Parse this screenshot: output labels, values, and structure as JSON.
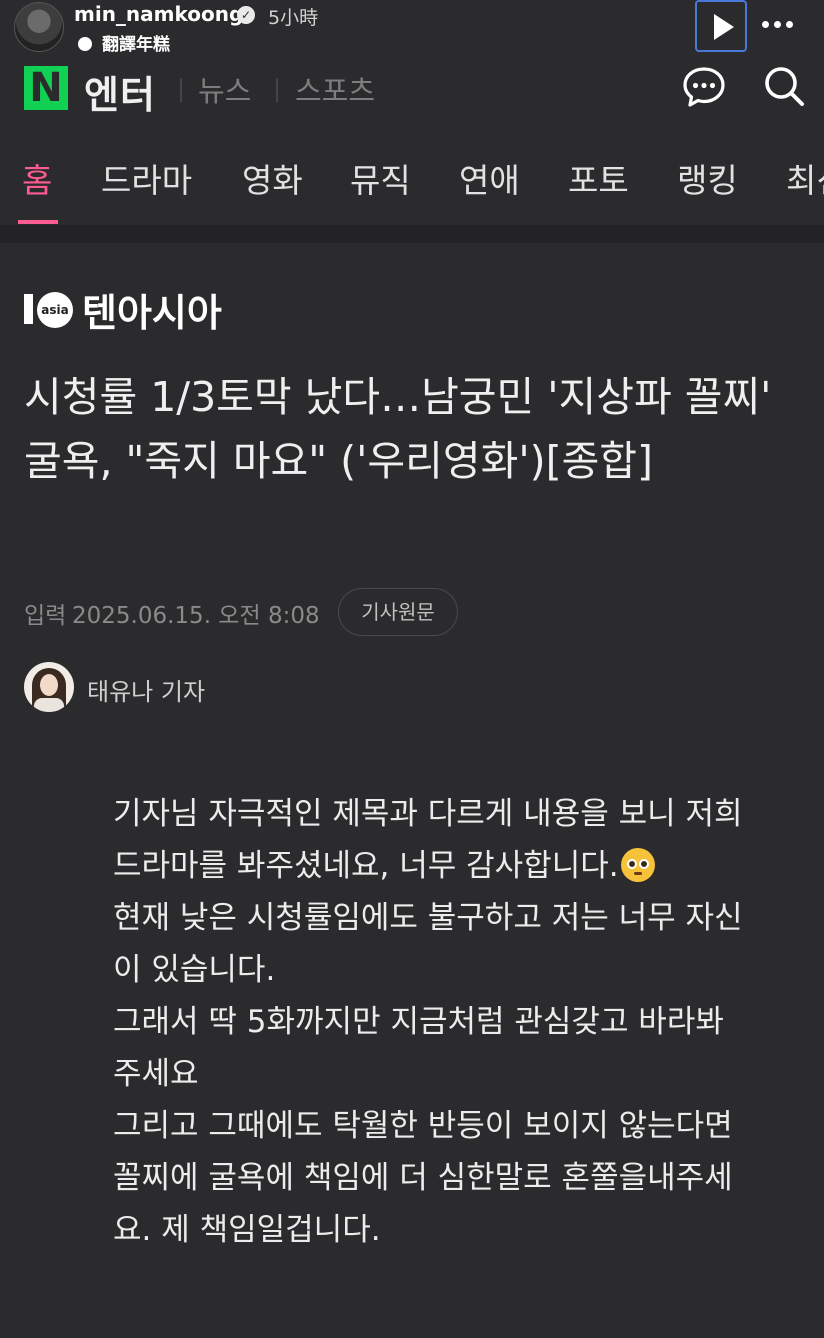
{
  "story": {
    "username": "min_namkoong",
    "verified_mark": "✓",
    "time": "5小時",
    "translation_label": "翻譯年糕"
  },
  "naver": {
    "logo": "N",
    "section": "엔터",
    "links": [
      "뉴스",
      "스포츠"
    ]
  },
  "tabs": [
    {
      "label": "홈",
      "active": true
    },
    {
      "label": "드라마"
    },
    {
      "label": "영화"
    },
    {
      "label": "뮤직"
    },
    {
      "label": "연애"
    },
    {
      "label": "포토"
    },
    {
      "label": "랭킹"
    },
    {
      "label": "최신"
    }
  ],
  "article": {
    "publisher_mark": "asia",
    "publisher_name": "텐아시아",
    "headline": "시청률 1/3토막 났다…남궁민 '지상파 꼴찌' 굴욕, \"죽지 마요\" ('우리영화')[종합]",
    "meta_label": "입력",
    "date": "2025.06.15. 오전 8:08",
    "original_button": "기사원문",
    "reporter": "태유나 기자",
    "quote_lines": [
      "기자님 자극적인 제목과 다르게 내용을 보니 저희 드라마를 봐주셨네요, 너무 감사합니다.",
      "현재 낮은 시청률임에도 불구하고 저는 너무 자신이 있습니다.",
      "그래서 딱 5화까지만 지금처럼 관심갖고 바라봐 주세요",
      "그리고 그때에도 탁월한 반등이 보이지 않는다면 꼴찌에 굴욕에 책임에 더 심한말로 혼쭐을내주세요. 제 책임일겁니다."
    ]
  },
  "colors": {
    "background": "#2b2b2d",
    "naver_green": "#11d155",
    "active_tab": "#ff5b93",
    "play_border": "#4a78d8"
  }
}
